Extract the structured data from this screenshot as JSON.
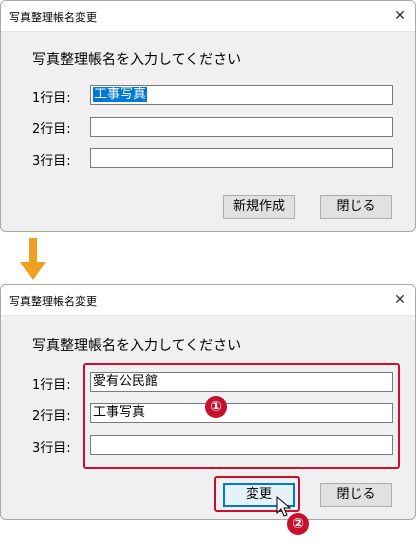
{
  "before": {
    "title": "写真整理帳名変更",
    "close_icon": "close-icon",
    "prompt": "写真整理帳名を入力してください",
    "rows": [
      {
        "label": "1行目:",
        "value": "工事写真"
      },
      {
        "label": "2行目:",
        "value": ""
      },
      {
        "label": "3行目:",
        "value": ""
      }
    ],
    "buttons": {
      "primary": "新規作成",
      "close": "閉じる"
    }
  },
  "after": {
    "title": "写真整理帳名変更",
    "close_icon": "close-icon",
    "prompt": "写真整理帳名を入力してください",
    "rows": [
      {
        "label": "1行目:",
        "value": "愛有公民館"
      },
      {
        "label": "2行目:",
        "value": "工事写真"
      },
      {
        "label": "3行目:",
        "value": ""
      }
    ],
    "buttons": {
      "primary": "変更",
      "close": "閉じる"
    }
  },
  "annotations": {
    "step1": "①",
    "step2": "②",
    "highlight_color": "#c8102e",
    "arrow_color": "#f0a020",
    "arrow_icon": "down-arrow-icon",
    "cursor_icon": "mouse-pointer-icon"
  }
}
